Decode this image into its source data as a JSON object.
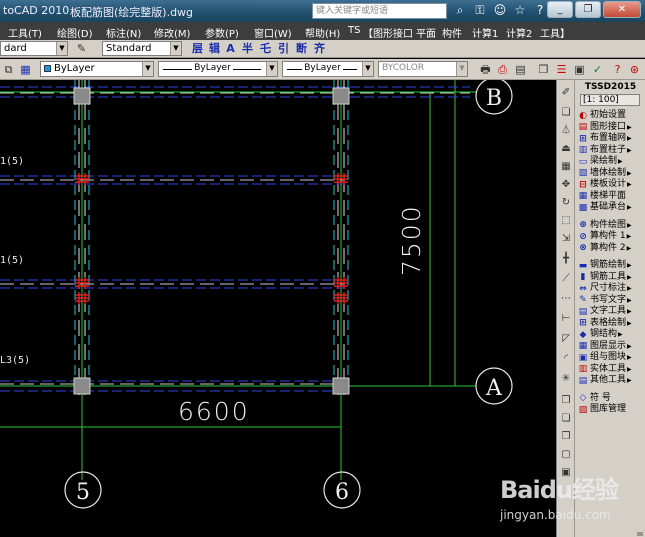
{
  "titlebar": {
    "app_title": "toCAD 2010",
    "file_name": "板配筋图(绘完整版).dwg",
    "search_placeholder": "键入关键字或短语",
    "icons": [
      "binoculars-icon",
      "key-icon",
      "user-icon",
      "star-icon",
      "help-icon"
    ],
    "window_buttons": [
      "_",
      "❐",
      "✕"
    ]
  },
  "menubar": {
    "items": [
      "工具(T)",
      "绘图(D)",
      "标注(N)",
      "修改(M)",
      "参数(P)",
      "窗口(W)",
      "帮助(H)",
      "TS",
      "【图形接口",
      "平面",
      "构件",
      "计算1",
      "计算2",
      "工具】"
    ]
  },
  "toolbar1": {
    "text_style": "dard",
    "dim_style": "Standard",
    "ts_buttons": [
      "层",
      "辑",
      "A",
      "半",
      "乇",
      "引",
      "断",
      "齐"
    ]
  },
  "toolbar2": {
    "color": "ByLayer",
    "linetype": "ByLayer",
    "lineweight": "ByLayer",
    "plotstyle": "BYCOLOR"
  },
  "drawing": {
    "beam_labels": [
      "1(5)",
      "1(5)",
      "L3(5)"
    ],
    "dim_vertical": "7500",
    "dim_horizontal": "6600",
    "grid_axes": [
      "B",
      "A",
      "5",
      "6"
    ]
  },
  "tssd": {
    "title": "TSSD2015",
    "scale": "[1: 100]",
    "items": [
      {
        "label": "初始设置",
        "icon": "settings-icon",
        "color": "#c00000",
        "arrow": false
      },
      {
        "label": "图形接口",
        "icon": "interface-icon",
        "color": "#c00000",
        "arrow": true
      },
      {
        "label": "布置轴网",
        "icon": "axis-grid-icon",
        "color": "#1a2cae",
        "arrow": true
      },
      {
        "label": "布置柱子",
        "icon": "column-icon",
        "color": "#1a2cae",
        "arrow": true
      },
      {
        "label": "梁绘制",
        "icon": "beam-icon",
        "color": "#1a2cae",
        "arrow": true
      },
      {
        "label": "墙体绘制",
        "icon": "wall-icon",
        "color": "#1a2cae",
        "arrow": true
      },
      {
        "label": "楼板设计",
        "icon": "slab-icon",
        "color": "#c00000",
        "arrow": true
      },
      {
        "label": "楼梯平面",
        "icon": "stair-icon",
        "color": "#1a2cae",
        "arrow": false
      },
      {
        "label": "基础承台",
        "icon": "foundation-icon",
        "color": "#1a2cae",
        "arrow": true
      },
      {
        "label": "构件绘图",
        "icon": "member-drawing-icon",
        "color": "#1a2cae",
        "arrow": true
      },
      {
        "label": "算构件 1",
        "icon": "calc1-icon",
        "color": "#1a2cae",
        "arrow": true
      },
      {
        "label": "算构件 2",
        "icon": "calc2-icon",
        "color": "#1a2cae",
        "arrow": true
      },
      {
        "label": "钢筋绘制",
        "icon": "rebar-draw-icon",
        "color": "#1a2cae",
        "arrow": true
      },
      {
        "label": "钢筋工具",
        "icon": "rebar-tool-icon",
        "color": "#1a2cae",
        "arrow": true
      },
      {
        "label": "尺寸标注",
        "icon": "dimension-icon",
        "color": "#1a2cae",
        "arrow": true
      },
      {
        "label": "书写文字",
        "icon": "write-text-icon",
        "color": "#1a2cae",
        "arrow": true
      },
      {
        "label": "文字工具",
        "icon": "text-tool-icon",
        "color": "#1a2cae",
        "arrow": true
      },
      {
        "label": "表格绘制",
        "icon": "table-icon",
        "color": "#1a2cae",
        "arrow": true
      },
      {
        "label": "钢结构",
        "icon": "steel-icon",
        "color": "#1a2cae",
        "arrow": true
      },
      {
        "label": "图层显示",
        "icon": "layer-icon",
        "color": "#1a2cae",
        "arrow": true
      },
      {
        "label": "组与图块",
        "icon": "block-icon",
        "color": "#1a2cae",
        "arrow": true
      },
      {
        "label": "实体工具",
        "icon": "entity-icon",
        "color": "#c00000",
        "arrow": true
      },
      {
        "label": "其他工具",
        "icon": "other-tools-icon",
        "color": "#1a2cae",
        "arrow": true
      },
      {
        "label": "符 号",
        "icon": "symbol-icon",
        "color": "#1a2cae",
        "arrow": false
      },
      {
        "label": "图库管理",
        "icon": "library-icon",
        "color": "#c00000",
        "arrow": false
      }
    ]
  },
  "watermark": {
    "main": "Baidu经验",
    "sub": "jingyan.baidu.com"
  }
}
